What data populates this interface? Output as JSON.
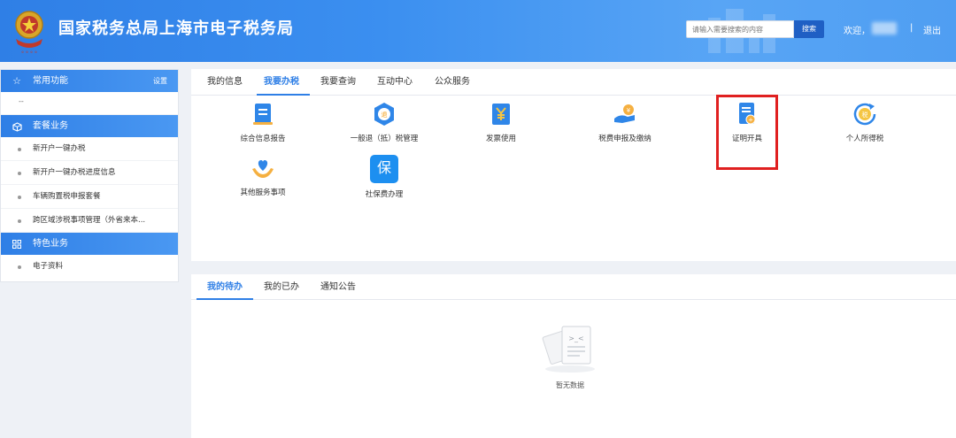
{
  "header": {
    "title": "国家税务总局上海市电子税务局",
    "search_placeholder": "请输入需要搜索的内容",
    "search_button": "搜索",
    "welcome": "欢迎，",
    "separator": "|",
    "logout": "退出",
    "brand_color": "#2f7fe6"
  },
  "sidebar": {
    "sections": [
      {
        "title": "常用功能",
        "icon": "star-icon",
        "setting": "设置"
      },
      {
        "title": "套餐业务",
        "icon": "box-icon"
      },
      {
        "title": "特色业务",
        "icon": "grid-icon"
      }
    ],
    "common_empty": "--",
    "package_items": [
      "新开户一键办税",
      "新开户一键办税进度信息",
      "车辆购置税申报套餐",
      "跨区域涉税事项管理（外省来本..."
    ],
    "special_items": [
      "电子资料"
    ]
  },
  "main_tabs": [
    "我的信息",
    "我要办税",
    "我要查询",
    "互动中心",
    "公众服务"
  ],
  "active_tab": "我要办税",
  "functions": [
    {
      "label": "综合信息报告",
      "icon": "report-icon"
    },
    {
      "label": "一般退（抵）税管理",
      "icon": "tax-refund-icon"
    },
    {
      "label": "发票使用",
      "icon": "invoice-icon"
    },
    {
      "label": "税费申报及缴纳",
      "icon": "tax-payment-icon"
    },
    {
      "label": "证明开具",
      "icon": "certificate-icon"
    },
    {
      "label": "个人所得税",
      "icon": "personal-tax-icon"
    },
    {
      "label": "其他服务事项",
      "icon": "heart-hands-icon"
    },
    {
      "label": "社保费办理",
      "icon": "social-security-icon",
      "icon_text": "保"
    }
  ],
  "highlight_color": "#e02020",
  "todo_tabs": [
    "我的待办",
    "我的已办",
    "通知公告"
  ],
  "active_todo_tab": "我的待办",
  "empty_text": "暂无数据"
}
